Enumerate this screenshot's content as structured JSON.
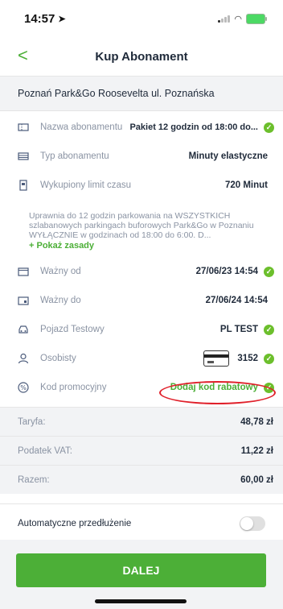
{
  "status_bar": {
    "time": "14:57"
  },
  "nav": {
    "title": "Kup Abonament"
  },
  "location": "Poznań Park&Go Roosevelta ul. Poznańska",
  "fields": {
    "subscription_name": {
      "label": "Nazwa abonamentu",
      "value": "Pakiet 12 godzin od 18:00 do..."
    },
    "subscription_type": {
      "label": "Typ abonamentu",
      "value": "Minuty elastyczne"
    },
    "time_limit": {
      "label": "Wykupiony limit czasu",
      "value": "720 Minut"
    }
  },
  "description": {
    "text": "Uprawnia do 12 godzin parkowania na WSZYSTKICH szlabanowych parkingach buforowych Park&Go w Poznaniu WYŁĄCZNIE w godzinach od 18:00 do 6:00. D...",
    "show_rules": "+ Pokaż zasady"
  },
  "validity": {
    "from": {
      "label": "Ważny od",
      "value": "27/06/23 14:54"
    },
    "to": {
      "label": "Ważny do",
      "value": "27/06/24 14:54"
    }
  },
  "vehicle": {
    "label": "Pojazd Testowy",
    "value": "PL TEST"
  },
  "payment": {
    "label": "Osobisty",
    "card_last4": "3152"
  },
  "promo": {
    "label": "Kod promocyjny",
    "action": "Dodaj kod rabatowy"
  },
  "totals": [
    {
      "label": "Taryfa:",
      "value": "48,78 zł"
    },
    {
      "label": "Podatek VAT:",
      "value": "11,22 zł"
    },
    {
      "label": "Razem:",
      "value": "60,00 zł"
    }
  ],
  "auto_renew": {
    "label": "Automatyczne przedłużenie",
    "enabled": false
  },
  "cta": {
    "label": "DALEJ"
  },
  "colors": {
    "accent": "#4caf37",
    "highlight": "#e0202a"
  }
}
